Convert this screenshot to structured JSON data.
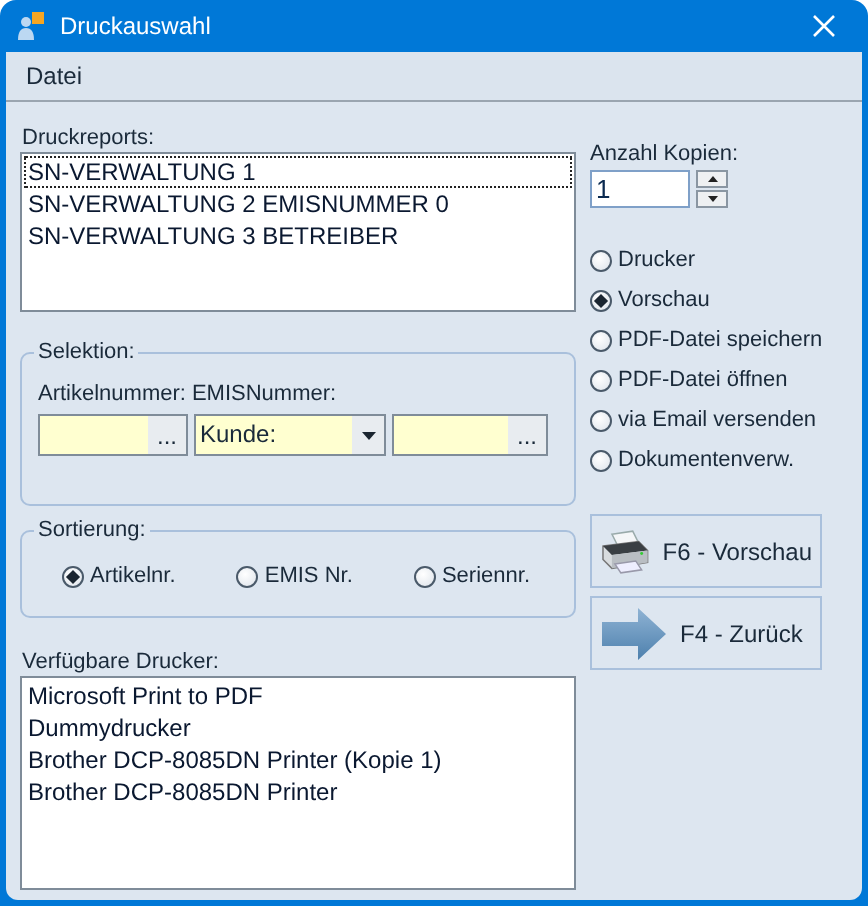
{
  "window": {
    "title": "Druckauswahl"
  },
  "menu": [
    {
      "label": "Datei"
    }
  ],
  "reports": {
    "label": "Druckreports:",
    "items": [
      {
        "text": "SN-VERWALTUNG 1",
        "selected": true
      },
      {
        "text": "SN-VERWALTUNG 2 EMISNUMMER 0",
        "selected": false
      },
      {
        "text": "SN-VERWALTUNG 3 BETREIBER",
        "selected": false
      }
    ]
  },
  "selection": {
    "title": "Selektion:",
    "labels": [
      "Artikelnummer:",
      "EMISNummer:"
    ],
    "fields": [
      {
        "kind": "browse",
        "button": "..."
      },
      {
        "kind": "dropdown",
        "value": "Kunde:"
      },
      {
        "kind": "browse",
        "button": "..."
      }
    ]
  },
  "sort": {
    "title": "Sortierung:",
    "options": [
      {
        "label": "Artikelnr.",
        "selected": true
      },
      {
        "label": "EMIS Nr.",
        "selected": false
      },
      {
        "label": "Seriennr.",
        "selected": false
      }
    ]
  },
  "printers": {
    "label": "Verfügbare Drucker:",
    "items": [
      "Microsoft Print to PDF",
      "Dummydrucker",
      "Brother DCP-8085DN Printer (Kopie 1)",
      "Brother DCP-8085DN Printer"
    ]
  },
  "copies": {
    "label": "Anzahl Kopien:",
    "value": "1"
  },
  "output": [
    {
      "label": "Drucker",
      "selected": false
    },
    {
      "label": "Vorschau",
      "selected": true
    },
    {
      "label": "PDF-Datei speichern",
      "selected": false
    },
    {
      "label": "PDF-Datei öffnen",
      "selected": false
    },
    {
      "label": "via Email versenden",
      "selected": false
    },
    {
      "label": "Dokumentenverw.",
      "selected": false
    }
  ],
  "buttons": [
    {
      "kind": "preview",
      "label": "F6 - Vorschau"
    },
    {
      "kind": "back",
      "label": "F4 - Zurück"
    }
  ]
}
